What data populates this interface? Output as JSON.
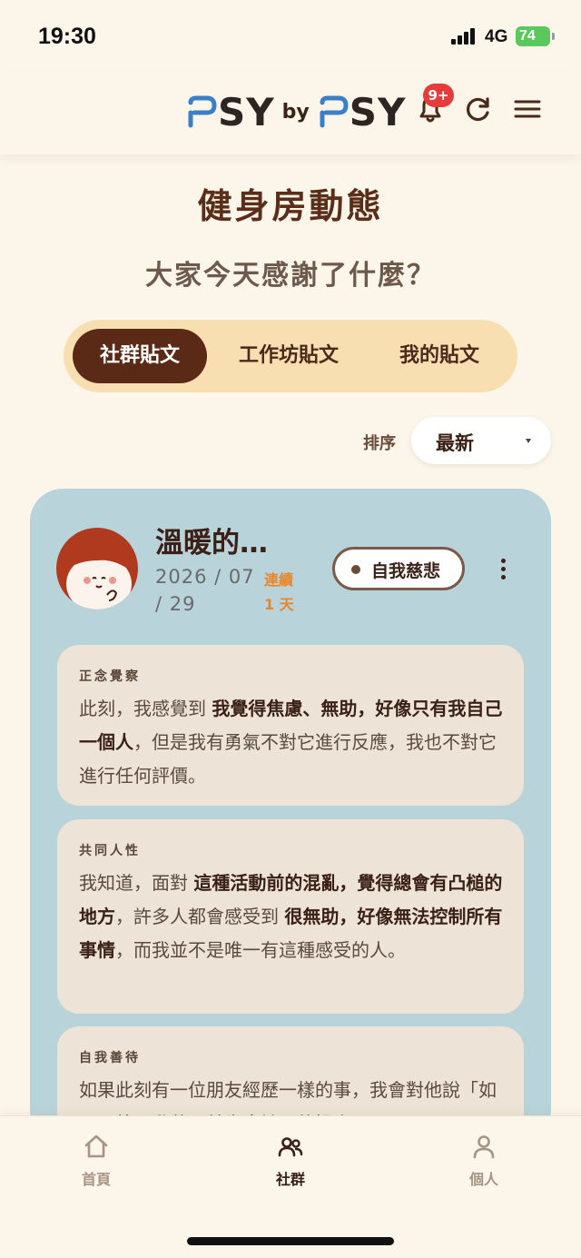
{
  "status_bar": {
    "time": "19:30",
    "network": "4G",
    "battery": "74"
  },
  "header": {
    "logo_left": "SY",
    "logo_by": "by",
    "logo_right": "SY",
    "notification_badge": "9+",
    "icons": [
      "bell-icon",
      "refresh-icon",
      "menu-icon"
    ],
    "brand_colors": {
      "blue": "#3a7fc8",
      "dark": "#2e2422"
    }
  },
  "page": {
    "title": "健身房動態",
    "subtitle": "大家今天感謝了什麼？"
  },
  "tabs": [
    {
      "label": "社群貼文",
      "active": true
    },
    {
      "label": "工作坊貼文",
      "active": false
    },
    {
      "label": "我的貼文",
      "active": false
    }
  ],
  "sort": {
    "label": "排序",
    "selected": "最新"
  },
  "post": {
    "author": "溫暖的…",
    "date": "2026 / 07 / 29",
    "streak_label": "連續",
    "streak_value": "1 天",
    "tag": "自我慈悲",
    "card_color": "#b8d3da",
    "sections": [
      {
        "label": "正念覺察",
        "text_parts": [
          {
            "t": "此刻，我感覺到 ",
            "b": false
          },
          {
            "t": "我覺得焦慮、無助，好像只有我自己一個人",
            "b": true
          },
          {
            "t": "，但是我有勇氣不對它進行反應，我也不對它進行任何評價。",
            "b": false
          }
        ]
      },
      {
        "label": "共同人性",
        "text_parts": [
          {
            "t": "我知道，面對 ",
            "b": false
          },
          {
            "t": "這種活動前的混亂，覺得總會有凸槌的地方",
            "b": true
          },
          {
            "t": "，許多人都會感受到 ",
            "b": false
          },
          {
            "t": "很無助，好像無法控制所有事情",
            "b": true
          },
          {
            "t": "，而我並不是唯一有這種感受的人。",
            "b": false
          }
        ]
      },
      {
        "label": "自我善待",
        "text_parts": [
          {
            "t": "如果此刻有一位朋友經歷一樣的事，我會對他說「如果要外面動著，首先應該要的操自己",
            "b": false
          }
        ]
      }
    ]
  },
  "bottom_nav": [
    {
      "label": "首頁",
      "icon": "home-icon",
      "active": false
    },
    {
      "label": "社群",
      "icon": "community-icon",
      "active": true
    },
    {
      "label": "個人",
      "icon": "person-icon",
      "active": false
    }
  ]
}
